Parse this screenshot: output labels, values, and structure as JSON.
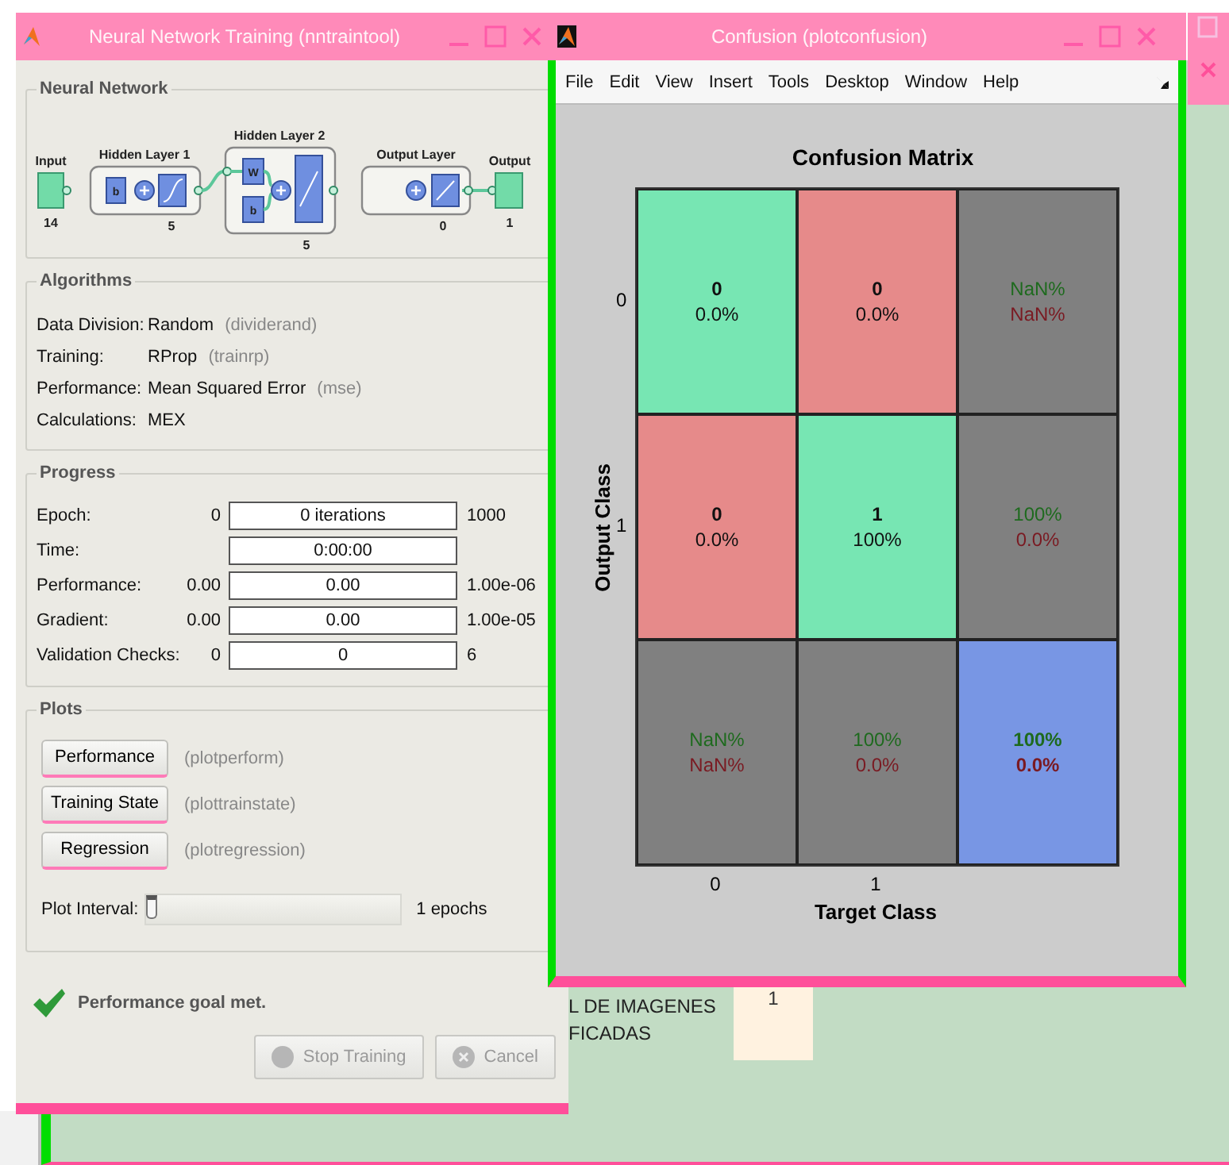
{
  "training_window": {
    "title": "Neural Network Training (nntraintool)",
    "network": {
      "title": "Neural Network",
      "input": {
        "label": "Input",
        "size": "14"
      },
      "hidden_1": {
        "label": "Hidden Layer 1",
        "size": "5",
        "bias": "b"
      },
      "hidden_2": {
        "label": "Hidden Layer 2",
        "size": "5",
        "weight": "W",
        "bias": "b"
      },
      "output_layer": {
        "label": "Output Layer",
        "size": "0"
      },
      "output": {
        "label": "Output",
        "size": "1"
      }
    },
    "algorithms": {
      "title": "Algorithms",
      "rows": [
        {
          "label": "Data Division:",
          "value": "Random",
          "function": "(dividerand)"
        },
        {
          "label": "Training:",
          "value": "RProp",
          "function": "(trainrp)"
        },
        {
          "label": "Performance:",
          "value": "Mean Squared Error",
          "function": "(mse)"
        },
        {
          "label": "Calculations:",
          "value": "MEX"
        }
      ]
    },
    "progress": {
      "title": "Progress",
      "rows": [
        {
          "label": "Epoch:",
          "start": "0",
          "current": "0 iterations",
          "target": "1000"
        },
        {
          "label": "Time:",
          "current": "0:00:00"
        },
        {
          "label": "Performance:",
          "start": "0.00",
          "current": "0.00",
          "target": "1.00e-06"
        },
        {
          "label": "Gradient:",
          "start": "0.00",
          "current": "0.00",
          "target": "1.00e-05"
        },
        {
          "label": "Validation Checks:",
          "start": "0",
          "current": "0",
          "target": "6"
        }
      ]
    },
    "plots": {
      "title": "Plots",
      "buttons": [
        {
          "label": "Performance",
          "function": "(plotperform)"
        },
        {
          "label": "Training State",
          "function": "(plottrainstate)"
        },
        {
          "label": "Regression",
          "function": "(plotregression)"
        }
      ],
      "interval": {
        "label": "Plot Interval:",
        "level": 0,
        "reading": "1 epochs"
      }
    },
    "status": "Performance goal met.",
    "buttons": [
      {
        "label": "Stop Training",
        "kind": "stop",
        "disabled": true
      },
      {
        "label": "Cancel",
        "kind": "cancel",
        "disabled": true
      }
    ]
  },
  "confusion_window": {
    "title": "Confusion (plotconfusion)",
    "menu": [
      "File",
      "Edit",
      "View",
      "Insert",
      "Tools",
      "Desktop",
      "Window",
      "Help"
    ],
    "matrix": {
      "title": "Confusion Matrix",
      "ylabel": "Output Class",
      "xlabel": "Target Class",
      "row_ticks": [
        "0",
        "1"
      ],
      "column_ticks": [
        "0",
        "1"
      ],
      "rows": [
        [
          {
            "kind": "correct",
            "lines": [
              "0",
              "0.0%"
            ]
          },
          {
            "kind": "incorrect",
            "lines": [
              "0",
              "0.0%"
            ]
          },
          {
            "kind": "summary",
            "lines": [
              "NaN%",
              "NaN%"
            ]
          }
        ],
        [
          {
            "kind": "incorrect",
            "lines": [
              "0",
              "0.0%"
            ]
          },
          {
            "kind": "correct",
            "lines": [
              "1",
              "100%"
            ]
          },
          {
            "kind": "summary",
            "lines": [
              "100%",
              "0.0%"
            ]
          }
        ],
        [
          {
            "kind": "summary",
            "lines": [
              "NaN%",
              "NaN%"
            ]
          },
          {
            "kind": "summary",
            "lines": [
              "100%",
              "0.0%"
            ]
          },
          {
            "kind": "total",
            "lines": [
              "100%",
              "0.0%"
            ]
          }
        ]
      ]
    }
  },
  "desktop": {
    "lines": [
      "L DE IMAGENES",
      "FICADAS"
    ],
    "cell": "1"
  }
}
